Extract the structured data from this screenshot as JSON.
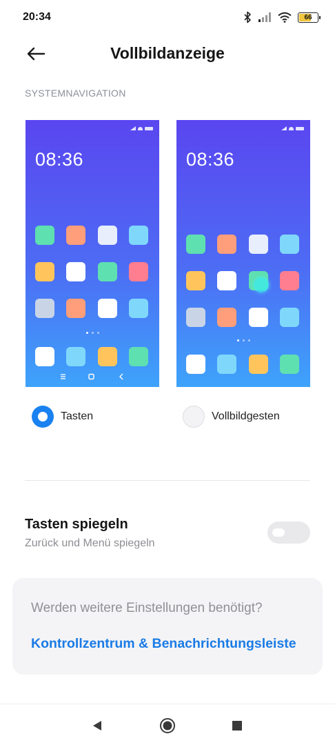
{
  "status_bar": {
    "time": "20:34",
    "icons": [
      "bluetooth-icon",
      "signal-icon",
      "wifi-icon",
      "battery-icon"
    ],
    "battery_level": "66"
  },
  "header": {
    "back_icon": "arrow-left-icon",
    "title": "Vollbildanzeige"
  },
  "section": {
    "label": "SYSTEMNAVIGATION"
  },
  "previews": [
    {
      "time": "08:36",
      "navigation": "buttons"
    },
    {
      "time": "08:36",
      "navigation": "gestures"
    }
  ],
  "options": [
    {
      "label": "Tasten",
      "selected": true
    },
    {
      "label": "Vollbildgesten",
      "selected": false
    }
  ],
  "mirror": {
    "title": "Tasten spiegeln",
    "subtitle": "Zurück und Menü spiegeln",
    "enabled": false
  },
  "more_settings": {
    "question": "Werden weitere Einstellungen benötigt?",
    "link": "Kontrollzentrum & Benachrichtungsleiste"
  },
  "system_nav": {
    "buttons": [
      "back-triangle-icon",
      "home-circle-icon",
      "recents-square-icon"
    ]
  },
  "colors": {
    "accent": "#1a82f0",
    "link": "#1a7be6",
    "tile_green": "#5fe0b0",
    "tile_orange": "#ff9e7a",
    "tile_white": "#ffffff",
    "tile_lightblue": "#7fd8fb",
    "tile_yellow": "#ffc55c",
    "tile_pink": "#ff7e8f",
    "tile_grey": "#c9d5e6"
  }
}
